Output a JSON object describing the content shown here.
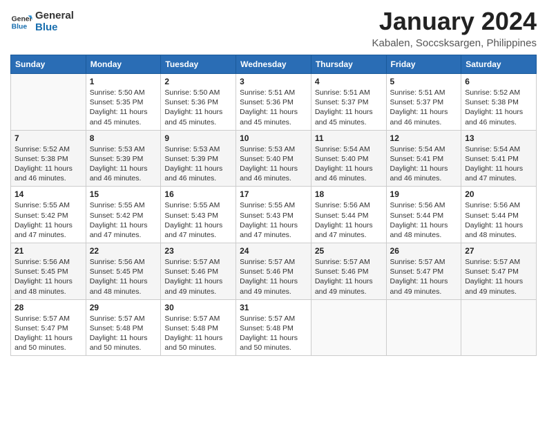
{
  "logo": {
    "line1": "General",
    "line2": "Blue"
  },
  "title": "January 2024",
  "location": "Kabalen, Soccsksargen, Philippines",
  "headers": [
    "Sunday",
    "Monday",
    "Tuesday",
    "Wednesday",
    "Thursday",
    "Friday",
    "Saturday"
  ],
  "weeks": [
    [
      {
        "day": "",
        "info": ""
      },
      {
        "day": "1",
        "info": "Sunrise: 5:50 AM\nSunset: 5:35 PM\nDaylight: 11 hours\nand 45 minutes."
      },
      {
        "day": "2",
        "info": "Sunrise: 5:50 AM\nSunset: 5:36 PM\nDaylight: 11 hours\nand 45 minutes."
      },
      {
        "day": "3",
        "info": "Sunrise: 5:51 AM\nSunset: 5:36 PM\nDaylight: 11 hours\nand 45 minutes."
      },
      {
        "day": "4",
        "info": "Sunrise: 5:51 AM\nSunset: 5:37 PM\nDaylight: 11 hours\nand 45 minutes."
      },
      {
        "day": "5",
        "info": "Sunrise: 5:51 AM\nSunset: 5:37 PM\nDaylight: 11 hours\nand 46 minutes."
      },
      {
        "day": "6",
        "info": "Sunrise: 5:52 AM\nSunset: 5:38 PM\nDaylight: 11 hours\nand 46 minutes."
      }
    ],
    [
      {
        "day": "7",
        "info": "Sunrise: 5:52 AM\nSunset: 5:38 PM\nDaylight: 11 hours\nand 46 minutes."
      },
      {
        "day": "8",
        "info": "Sunrise: 5:53 AM\nSunset: 5:39 PM\nDaylight: 11 hours\nand 46 minutes."
      },
      {
        "day": "9",
        "info": "Sunrise: 5:53 AM\nSunset: 5:39 PM\nDaylight: 11 hours\nand 46 minutes."
      },
      {
        "day": "10",
        "info": "Sunrise: 5:53 AM\nSunset: 5:40 PM\nDaylight: 11 hours\nand 46 minutes."
      },
      {
        "day": "11",
        "info": "Sunrise: 5:54 AM\nSunset: 5:40 PM\nDaylight: 11 hours\nand 46 minutes."
      },
      {
        "day": "12",
        "info": "Sunrise: 5:54 AM\nSunset: 5:41 PM\nDaylight: 11 hours\nand 46 minutes."
      },
      {
        "day": "13",
        "info": "Sunrise: 5:54 AM\nSunset: 5:41 PM\nDaylight: 11 hours\nand 47 minutes."
      }
    ],
    [
      {
        "day": "14",
        "info": "Sunrise: 5:55 AM\nSunset: 5:42 PM\nDaylight: 11 hours\nand 47 minutes."
      },
      {
        "day": "15",
        "info": "Sunrise: 5:55 AM\nSunset: 5:42 PM\nDaylight: 11 hours\nand 47 minutes."
      },
      {
        "day": "16",
        "info": "Sunrise: 5:55 AM\nSunset: 5:43 PM\nDaylight: 11 hours\nand 47 minutes."
      },
      {
        "day": "17",
        "info": "Sunrise: 5:55 AM\nSunset: 5:43 PM\nDaylight: 11 hours\nand 47 minutes."
      },
      {
        "day": "18",
        "info": "Sunrise: 5:56 AM\nSunset: 5:44 PM\nDaylight: 11 hours\nand 47 minutes."
      },
      {
        "day": "19",
        "info": "Sunrise: 5:56 AM\nSunset: 5:44 PM\nDaylight: 11 hours\nand 48 minutes."
      },
      {
        "day": "20",
        "info": "Sunrise: 5:56 AM\nSunset: 5:44 PM\nDaylight: 11 hours\nand 48 minutes."
      }
    ],
    [
      {
        "day": "21",
        "info": "Sunrise: 5:56 AM\nSunset: 5:45 PM\nDaylight: 11 hours\nand 48 minutes."
      },
      {
        "day": "22",
        "info": "Sunrise: 5:56 AM\nSunset: 5:45 PM\nDaylight: 11 hours\nand 48 minutes."
      },
      {
        "day": "23",
        "info": "Sunrise: 5:57 AM\nSunset: 5:46 PM\nDaylight: 11 hours\nand 49 minutes."
      },
      {
        "day": "24",
        "info": "Sunrise: 5:57 AM\nSunset: 5:46 PM\nDaylight: 11 hours\nand 49 minutes."
      },
      {
        "day": "25",
        "info": "Sunrise: 5:57 AM\nSunset: 5:46 PM\nDaylight: 11 hours\nand 49 minutes."
      },
      {
        "day": "26",
        "info": "Sunrise: 5:57 AM\nSunset: 5:47 PM\nDaylight: 11 hours\nand 49 minutes."
      },
      {
        "day": "27",
        "info": "Sunrise: 5:57 AM\nSunset: 5:47 PM\nDaylight: 11 hours\nand 49 minutes."
      }
    ],
    [
      {
        "day": "28",
        "info": "Sunrise: 5:57 AM\nSunset: 5:47 PM\nDaylight: 11 hours\nand 50 minutes."
      },
      {
        "day": "29",
        "info": "Sunrise: 5:57 AM\nSunset: 5:48 PM\nDaylight: 11 hours\nand 50 minutes."
      },
      {
        "day": "30",
        "info": "Sunrise: 5:57 AM\nSunset: 5:48 PM\nDaylight: 11 hours\nand 50 minutes."
      },
      {
        "day": "31",
        "info": "Sunrise: 5:57 AM\nSunset: 5:48 PM\nDaylight: 11 hours\nand 50 minutes."
      },
      {
        "day": "",
        "info": ""
      },
      {
        "day": "",
        "info": ""
      },
      {
        "day": "",
        "info": ""
      }
    ]
  ]
}
